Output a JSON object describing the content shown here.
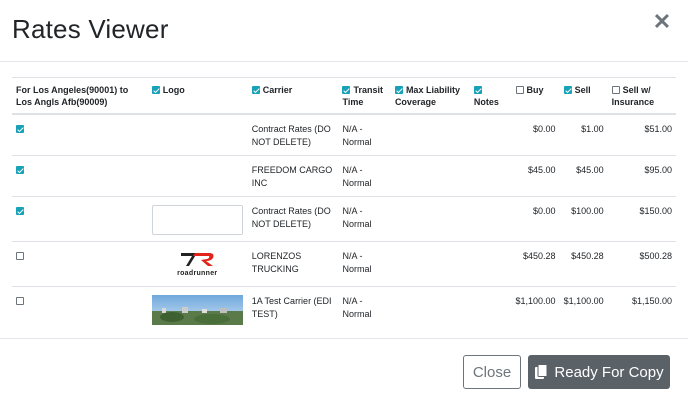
{
  "dialog": {
    "title": "Rates Viewer",
    "close_symbol": "✕"
  },
  "table": {
    "headers": {
      "route": "For Los Angeles(90001) to Los Angls Afb(90009)",
      "logo": "Logo",
      "carrier": "Carrier",
      "transit": "Transit Time",
      "liability": "Max Liability Coverage",
      "notes": "Notes",
      "buy": "Buy",
      "sell": "Sell",
      "sell_ins": "Sell w/ Insurance"
    },
    "header_checks": {
      "logo": true,
      "carrier": true,
      "transit": true,
      "liability": true,
      "notes": true,
      "buy": false,
      "sell": true,
      "sell_ins": false
    },
    "rows": [
      {
        "checked": true,
        "logo": "none",
        "carrier": "Contract Rates (DO NOT DELETE)",
        "transit": "N/A - Normal",
        "liability": "",
        "notes": "",
        "buy": "$0.00",
        "sell": "$1.00",
        "sell_ins": "$51.00"
      },
      {
        "checked": true,
        "logo": "none",
        "carrier": "FREEDOM CARGO INC",
        "transit": "N/A - Normal",
        "liability": "",
        "notes": "",
        "buy": "$45.00",
        "sell": "$45.00",
        "sell_ins": "$95.00"
      },
      {
        "checked": true,
        "logo": "blank",
        "carrier": "Contract Rates (DO NOT DELETE)",
        "transit": "N/A - Normal",
        "liability": "",
        "notes": "",
        "buy": "$0.00",
        "sell": "$100.00",
        "sell_ins": "$150.00"
      },
      {
        "checked": false,
        "logo": "roadrunner",
        "carrier": "LORENZOS TRUCKING",
        "transit": "N/A - Normal",
        "liability": "",
        "notes": "",
        "buy": "$450.28",
        "sell": "$450.28",
        "sell_ins": "$500.28"
      },
      {
        "checked": false,
        "logo": "photo",
        "carrier": "1A Test Carrier (EDI TEST)",
        "transit": "N/A - Normal",
        "liability": "",
        "notes": "",
        "buy": "$1,100.00",
        "sell": "$1,100.00",
        "sell_ins": "$1,150.00"
      }
    ],
    "roadrunner_logo_text": "roadrunner"
  },
  "footer": {
    "close_label": "Close",
    "copy_label": "Ready For Copy"
  },
  "colors": {
    "accent": "#17a2b8",
    "copy_button": "#5a6268",
    "roadrunner_red": "#e2231a"
  }
}
